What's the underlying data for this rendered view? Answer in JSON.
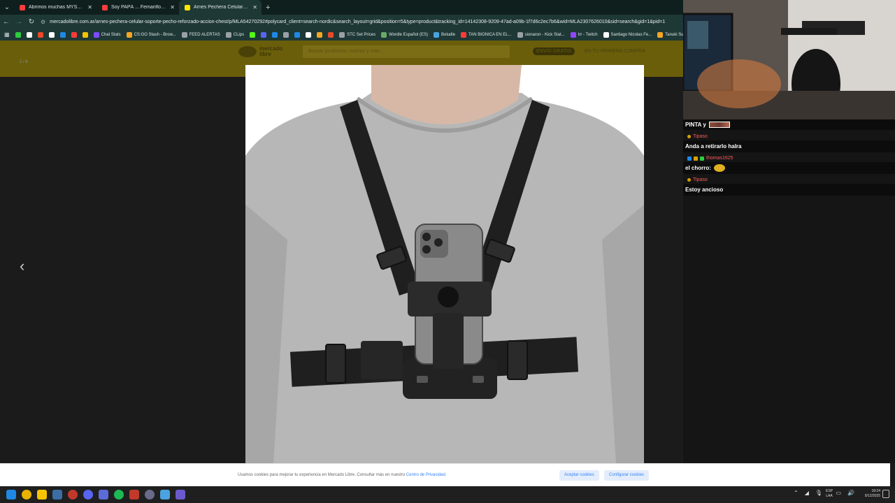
{
  "browser": {
    "tabs": [
      {
        "title": "Abrimos muchas MYSTERY BOX",
        "favicon_color": "#ff3b3b",
        "active": false
      },
      {
        "title": "Soy PAPÁ ... Femanfloo - YouTube",
        "favicon_color": "#ff3b3b",
        "active": false
      },
      {
        "title": "Arnes Pechera Celular Soporte",
        "favicon_color": "#ffe600",
        "active": true
      }
    ],
    "url": "mercadolibre.com.ar/arnes-pechera-celular-soporte-pecho-reforzado-accion-chest/p/MLA54270292#polycard_client=search-nordic&search_layout=grid&position=5&type=product&tracking_id=14142308-9209-47ad-a09b-1f7d6c2ec7b6&wid=MLA2307626010&sid=search&gid=1&pid=1",
    "bookmarks": [
      {
        "label": "",
        "color": "#2ecc40"
      },
      {
        "label": "",
        "color": "#ffffff"
      },
      {
        "label": "",
        "color": "#e84a27"
      },
      {
        "label": "",
        "color": "#ffffff"
      },
      {
        "label": "",
        "color": "#1e88e5"
      },
      {
        "label": "",
        "color": "#ff3b3b"
      },
      {
        "label": "",
        "color": "#f5c400"
      },
      {
        "label": "Chat Stats",
        "color": "#7b4cff"
      },
      {
        "label": "CS:GO Stash - Brow...",
        "color": "#f5a623"
      },
      {
        "label": "FEED ALERTAS",
        "color": "#9aa0a6"
      },
      {
        "label": "CLips",
        "color": "#9aa0a6"
      },
      {
        "label": "",
        "color": "#53fc18"
      },
      {
        "label": "",
        "color": "#5865f2"
      },
      {
        "label": "",
        "color": "#1e88e5"
      },
      {
        "label": "",
        "color": "#9aa0a6"
      },
      {
        "label": "",
        "color": "#1e88e5"
      },
      {
        "label": "",
        "color": "#ffffff"
      },
      {
        "label": "",
        "color": "#f5a623"
      },
      {
        "label": "",
        "color": "#e84a27"
      },
      {
        "label": "STC Set Prices",
        "color": "#9aa0a6"
      },
      {
        "label": "Wordle Español (ES)",
        "color": "#6aaa64"
      },
      {
        "label": "Boludle",
        "color": "#4aa3df"
      },
      {
        "label": "TAN BIONICA EN EL...",
        "color": "#ff3b3b"
      },
      {
        "label": "sionaron - Kick Stat...",
        "color": "#9aa0a6"
      },
      {
        "label": "trr - Twitch",
        "color": "#9146ff"
      },
      {
        "label": "Santiago Nicolas Fe...",
        "color": "#ffffff"
      },
      {
        "label": "Tanuki Sunset",
        "color": "#f5a623"
      }
    ]
  },
  "page": {
    "logo_text": "mercado libre",
    "search_placeholder": "Buscar productos, marcas y más...",
    "envio_badge": "ENVÍO GRATIS",
    "envio_sub": "EN TU PRIMERA COMPRA",
    "image_counter": "1 / 6",
    "cookie_text": "Usamos cookies para mejorar tu experiencia en Mercado Libre. Consultar más en nuestro",
    "cookie_link": "Centro de Privacidad.",
    "accept_cookies": "Aceptar cookies",
    "configure_cookies": "Configurar cookies"
  },
  "chat": {
    "header_name": "PINTA y",
    "messages": [
      {
        "user": "Tipaso",
        "text": "Anda a retirarlo halra",
        "emote": ""
      },
      {
        "user": "thomas1625",
        "text": "el chorro:",
        "emote": "round"
      },
      {
        "user": "Tipaso",
        "text": "Estoy ancioso",
        "emote": ""
      }
    ]
  },
  "taskbar": {
    "lang_top": "ESP",
    "lang_bottom": "LAA",
    "time": "18:24",
    "date": "9/12/2025"
  }
}
